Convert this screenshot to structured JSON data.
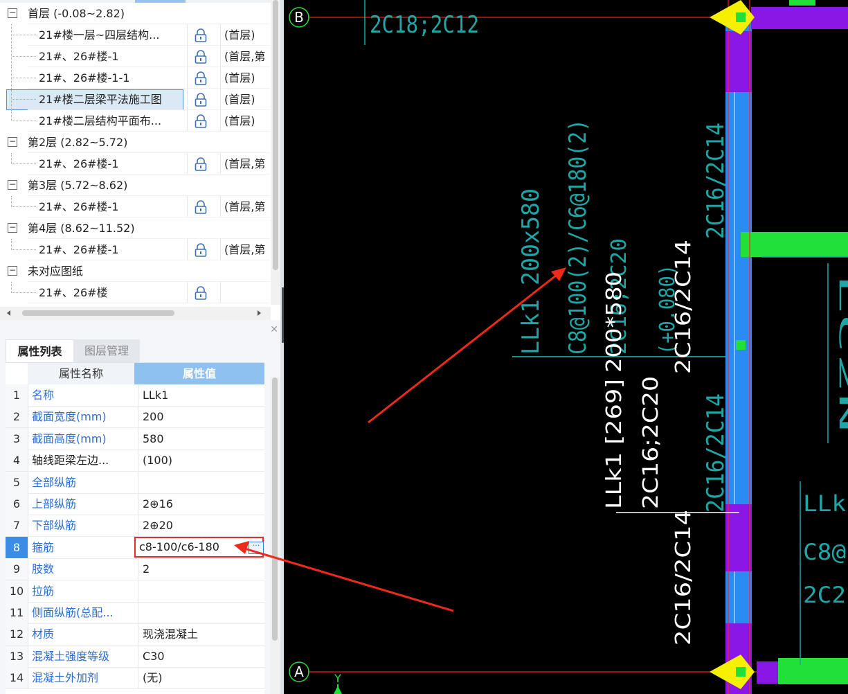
{
  "tree": {
    "rows": [
      {
        "kind": "group",
        "label": "首层 (-0.08~2.82)",
        "toggle": "−"
      },
      {
        "kind": "leaf",
        "name": "21#楼一层~四层结构...",
        "layer": "(首层)"
      },
      {
        "kind": "leaf",
        "name": "21#、26#楼-1",
        "layer": "(首层,第"
      },
      {
        "kind": "leaf",
        "name": "21#、26#楼-1-1",
        "layer": "(首层)"
      },
      {
        "kind": "leaf",
        "name": "21#楼二层梁平法施工图",
        "layer": "(首层)",
        "selected": true
      },
      {
        "kind": "leaf",
        "name": "21#楼二层结构平面布...",
        "layer": "(首层)"
      },
      {
        "kind": "group",
        "label": "第2层 (2.82~5.72)",
        "toggle": "−"
      },
      {
        "kind": "leaf",
        "name": "21#、26#楼-1",
        "layer": "(首层,第"
      },
      {
        "kind": "group",
        "label": "第3层 (5.72~8.62)",
        "toggle": "−"
      },
      {
        "kind": "leaf",
        "name": "21#、26#楼-1",
        "layer": "(首层,第"
      },
      {
        "kind": "group",
        "label": "第4层 (8.62~11.52)",
        "toggle": "−"
      },
      {
        "kind": "leaf",
        "name": "21#、26#楼-1",
        "layer": "(首层,第"
      },
      {
        "kind": "group",
        "label": "未对应图纸",
        "toggle": "−"
      },
      {
        "kind": "leaf",
        "name": "21#、26#楼",
        "layer": ""
      }
    ]
  },
  "tabs": {
    "properties": "属性列表",
    "layers": "图层管理"
  },
  "props": {
    "header_name": "属性名称",
    "header_value": "属性值",
    "rows": [
      {
        "num": "1",
        "name": "名称",
        "value": "LLk1",
        "blue": true
      },
      {
        "num": "2",
        "name": "截面宽度(mm)",
        "value": "200",
        "blue": true
      },
      {
        "num": "3",
        "name": "截面高度(mm)",
        "value": "580",
        "blue": true
      },
      {
        "num": "4",
        "name": "轴线距梁左边...",
        "value": "(100)",
        "blue": false
      },
      {
        "num": "5",
        "name": "全部纵筋",
        "value": "",
        "blue": true
      },
      {
        "num": "6",
        "name": "上部纵筋",
        "value": "2⊕16",
        "blue": true
      },
      {
        "num": "7",
        "name": "下部纵筋",
        "value": "2⊕20",
        "blue": true
      },
      {
        "num": "8",
        "name": "箍筋",
        "value": "c8-100/c6-180",
        "blue": true,
        "editing": true
      },
      {
        "num": "9",
        "name": "肢数",
        "value": "2",
        "blue": true
      },
      {
        "num": "10",
        "name": "拉筋",
        "value": "",
        "blue": true
      },
      {
        "num": "11",
        "name": "侧面纵筋(总配...",
        "value": "",
        "blue": true
      },
      {
        "num": "12",
        "name": "材质",
        "value": "现浇混凝土",
        "blue": true
      },
      {
        "num": "13",
        "name": "混凝土强度等级",
        "value": "C30",
        "blue": true
      },
      {
        "num": "14",
        "name": "混凝土外加剂",
        "value": "(无)",
        "blue": true
      }
    ]
  },
  "canvas": {
    "axis_top": "B",
    "axis_bottom": "A",
    "y_axis": "Y",
    "texts": {
      "top_label": "2C18;2C12",
      "cad_name": "LLk1 200x580",
      "cad_stirrup": "C8@100(2)/C6@180(2)",
      "cad_bottom": "2C16;2C20",
      "cad_offset": "(+0.080)",
      "cad_side_top": "2C16/2C14",
      "cad_side_bottom": "2C16/2C14",
      "lbl_size": "200*580",
      "lbl_side_top": "2C16/2C14",
      "lbl_name": "LLk1 [269]",
      "lbl_rebar": "2C16;2C20",
      "lbl_side_bottom": "2C16/2C14",
      "right_line1": "LLk",
      "right_line2": "C8@",
      "right_line3": "2C2",
      "right_far": "LC2N"
    }
  },
  "colors": {
    "cyan": "#1fa6a6",
    "white_text": "#ffffff",
    "column_blue": "#2a8cf0",
    "purple": "#8b17e6",
    "green": "#22e03a",
    "yellow": "#f5f000",
    "red_line": "#ff2020",
    "arrow_red": "#ee2a1a"
  }
}
